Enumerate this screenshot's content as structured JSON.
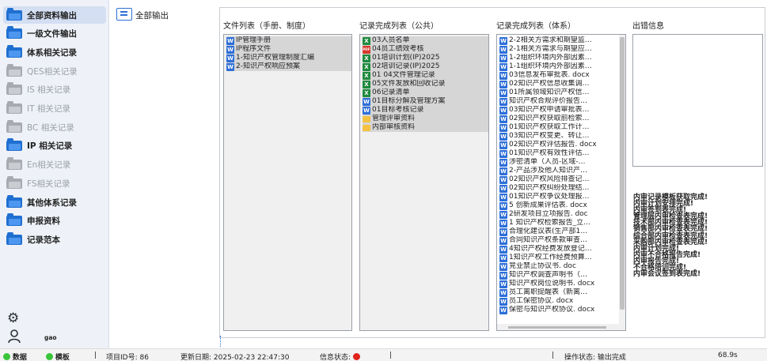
{
  "sidebar": {
    "items": [
      {
        "label": "全部资料输出",
        "state": "active"
      },
      {
        "label": "一级文件输出",
        "state": "enabled"
      },
      {
        "label": "体系相关记录",
        "state": "enabled"
      },
      {
        "label": "QES相关记录",
        "state": "disabled"
      },
      {
        "label": "IS 相关记录",
        "state": "disabled"
      },
      {
        "label": "IT 相关记录",
        "state": "disabled"
      },
      {
        "label": "BC 相关记录",
        "state": "disabled"
      },
      {
        "label": "IP 相关记录",
        "state": "enabled"
      },
      {
        "label": "En相关记录",
        "state": "disabled"
      },
      {
        "label": "FS相关记录",
        "state": "disabled"
      },
      {
        "label": "其他体系记录",
        "state": "enabled"
      },
      {
        "label": "申报资料",
        "state": "enabled"
      },
      {
        "label": "记录范本",
        "state": "enabled"
      }
    ],
    "settings_icon": "gear-icon",
    "user_icon": "user-icon",
    "user_name": "gao"
  },
  "header": {
    "title": "全部输出",
    "icon": "list-icon"
  },
  "columns": {
    "files": {
      "title": "文件列表（手册、制度）",
      "items": [
        {
          "type": "word",
          "label": "IP管理手册"
        },
        {
          "type": "word",
          "label": "IP程序文件"
        },
        {
          "type": "word",
          "label": "1-知识产权管理制度汇编"
        },
        {
          "type": "word",
          "label": "2-知识产权响应预案"
        }
      ]
    },
    "public": {
      "title": "记录完成列表（公共）",
      "items": [
        {
          "type": "excel",
          "label": "03人员名单"
        },
        {
          "type": "pdf",
          "label": "04员工绩效考核"
        },
        {
          "type": "excel",
          "label": "01培训计划(IP)2025"
        },
        {
          "type": "excel",
          "label": "02培训记录(IP)2025"
        },
        {
          "type": "excel",
          "label": "01 04文件管理记录"
        },
        {
          "type": "excel",
          "label": "05文件发放和回收记录"
        },
        {
          "type": "excel",
          "label": "06记录清单"
        },
        {
          "type": "word",
          "label": "01目标分解及管理方案"
        },
        {
          "type": "word",
          "label": "01目标考核记录"
        },
        {
          "type": "folder",
          "label": "管理评审资料"
        },
        {
          "type": "folder",
          "label": "内部审核资料"
        }
      ]
    },
    "system": {
      "title": "记录完成列表（体系）",
      "items": [
        {
          "type": "word",
          "label": "2-2相关方需求和期望监…"
        },
        {
          "type": "word",
          "label": "2-1相关方需求与期望应…"
        },
        {
          "type": "word",
          "label": "1-2组织环境内外部因素…"
        },
        {
          "type": "word",
          "label": "1-1组织环境内外部因素…"
        },
        {
          "type": "word",
          "label": "03信息发布审批表. docx"
        },
        {
          "type": "word",
          "label": "02知识产权信息收集调…"
        },
        {
          "type": "word",
          "label": "01所属领域知识产权信…"
        },
        {
          "type": "word",
          "label": "知识产权合规评价报告…"
        },
        {
          "type": "word",
          "label": "03知识产权申请审批表…"
        },
        {
          "type": "word",
          "label": "02知识产权获取前检索…"
        },
        {
          "type": "word",
          "label": "01知识产权获取工作计…"
        },
        {
          "type": "word",
          "label": "03知识产权变更、转让…"
        },
        {
          "type": "word",
          "label": "02知识产权评估报告. docx"
        },
        {
          "type": "word",
          "label": "01知识产权有效性评估…"
        },
        {
          "type": "word",
          "label": "涉密清单（人员-区域-…"
        },
        {
          "type": "word",
          "label": "2-产品涉及他人知识产…"
        },
        {
          "type": "word",
          "label": "02知识产权风险排查记…"
        },
        {
          "type": "word",
          "label": "02知识产权纠纷处理结…"
        },
        {
          "type": "word",
          "label": "01知识产权争议处理报…"
        },
        {
          "type": "word",
          "label": "5 创新成果评估表. docx"
        },
        {
          "type": "word",
          "label": "2研发项目立项报告. doc"
        },
        {
          "type": "word",
          "label": "1 知识产权检索报告_立…"
        },
        {
          "type": "word",
          "label": "合理化建议表(生产部1…"
        },
        {
          "type": "word",
          "label": "合同知识产权条款审查…"
        },
        {
          "type": "word",
          "label": "4知识产权经费发放登记…"
        },
        {
          "type": "word",
          "label": "1知识产权工作经费预算…"
        },
        {
          "type": "word",
          "label": "竞业禁止协议书. doc"
        },
        {
          "type": "word",
          "label": "知识产权调查声明书（…"
        },
        {
          "type": "word",
          "label": "知识产权岗位说明书. docx"
        },
        {
          "type": "word",
          "label": "员工离职提醒表（新离…"
        },
        {
          "type": "word",
          "label": "员工保密协议. docx"
        },
        {
          "type": "word",
          "label": "保密与知识产权协议. docx"
        }
      ]
    },
    "errors": {
      "title": "出错信息"
    }
  },
  "log": [
    "内审记录模板获取完成!",
    "内审计划安排完成!",
    "内审签到表完成!",
    "管理层内审检查表完成!",
    "技术部内审检查表完成!",
    "销售部内审检查表完成!",
    "综合部内审检查表完成!",
    "采购部内审检查表完成!",
    "内审计划完成!",
    "内审不合格报告完成!",
    "内审报告完成!",
    "不合格培训完成!",
    "内审会议签到表完成!"
  ],
  "status": {
    "data_label": "数据",
    "template_label": "模板",
    "project_id": "项目ID号: 86",
    "updated": "更新日期: 2025-02-23 22:47:30",
    "info_status": "信息状态:",
    "operation": "操作状态: 输出完成",
    "value": "68.9s",
    "colors": {
      "ok": "#39c53a",
      "error": "#e0231b"
    }
  }
}
